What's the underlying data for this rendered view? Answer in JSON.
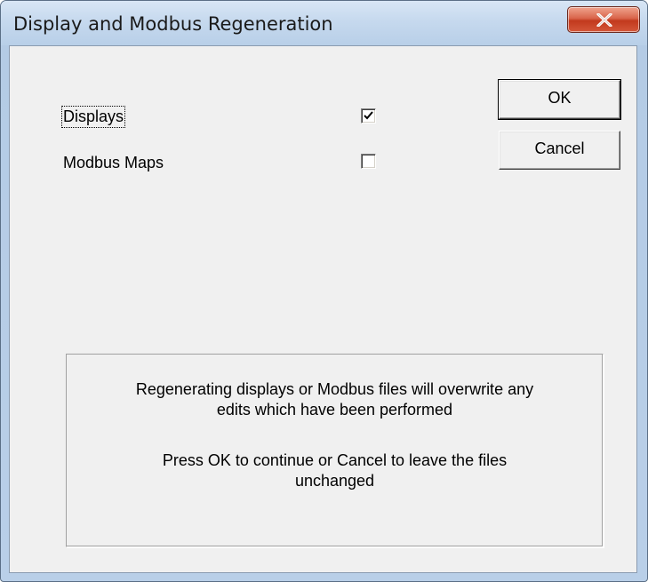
{
  "window": {
    "title": "Display and Modbus Regeneration",
    "close_icon": "close-x-icon",
    "close_color": "#c2391d"
  },
  "options": [
    {
      "label": "Displays",
      "checked": true
    },
    {
      "label": "Modbus Maps",
      "checked": false
    }
  ],
  "buttons": {
    "ok_label": "OK",
    "cancel_label": "Cancel"
  },
  "message": {
    "line1": "Regenerating displays or Modbus files will overwrite any",
    "line2": "edits which have been performed",
    "line3": "Press OK to continue or Cancel to leave the files",
    "line4": "unchanged"
  },
  "colors": {
    "dialog_background": "#f0f0f0",
    "frame": "#b9cfe8"
  }
}
